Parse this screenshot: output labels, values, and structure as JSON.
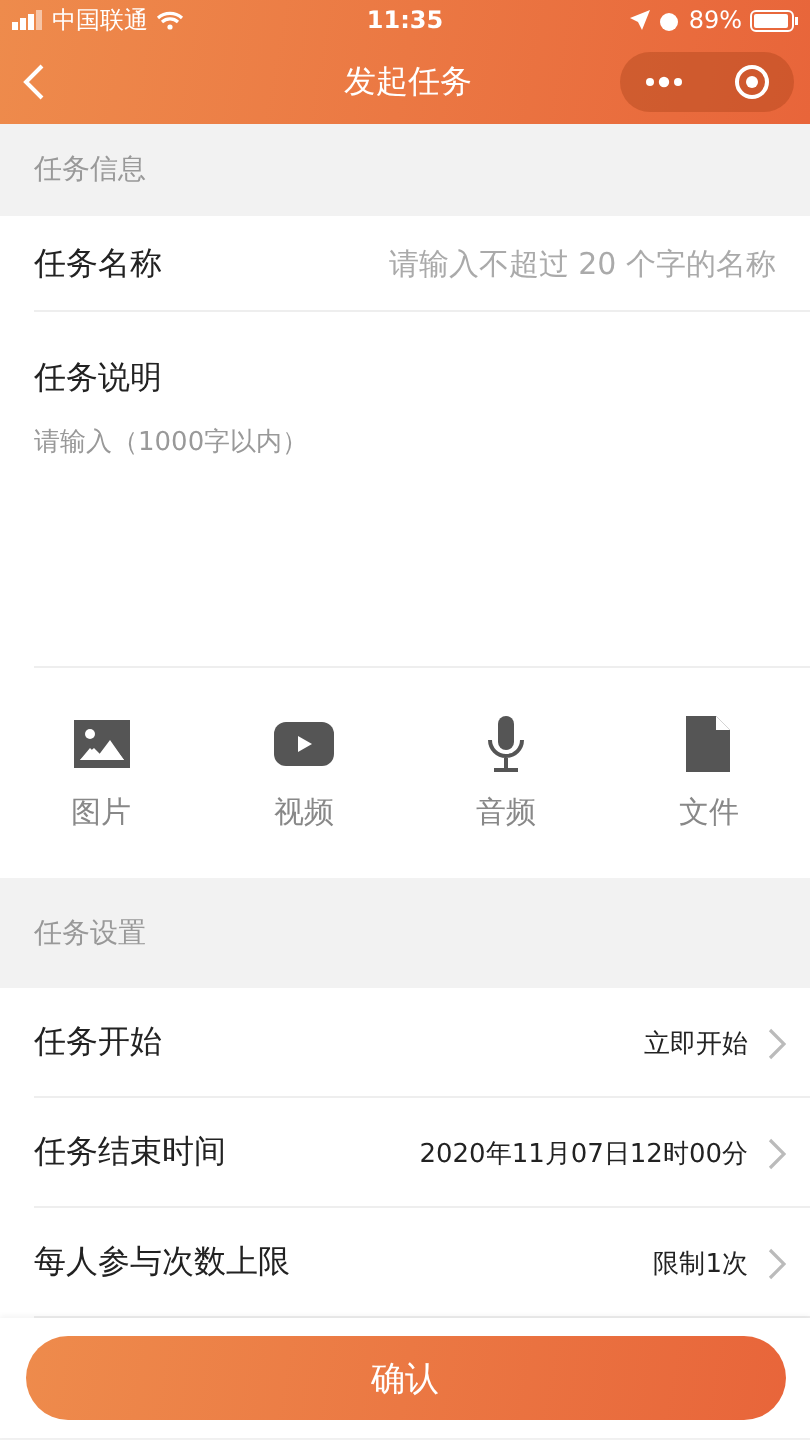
{
  "status_bar": {
    "carrier": "中国联通",
    "time": "11:35",
    "battery": "89%"
  },
  "nav": {
    "title": "发起任务"
  },
  "sections": [
    {
      "title": "任务信息"
    },
    {
      "title": "任务设置"
    }
  ],
  "task_name": {
    "label": "任务名称",
    "placeholder": "请输入不超过 20 个字的名称"
  },
  "task_description": {
    "label": "任务说明",
    "placeholder": "请输入（1000字以内）"
  },
  "attachments": [
    {
      "kind": "image",
      "label": "图片"
    },
    {
      "kind": "video",
      "label": "视频"
    },
    {
      "kind": "audio",
      "label": "音频"
    },
    {
      "kind": "file",
      "label": "文件"
    }
  ],
  "settings": [
    {
      "label": "任务开始",
      "value": "立即开始"
    },
    {
      "label": "任务结束时间",
      "value": "2020年11月07日12时00分"
    },
    {
      "label": "每人参与次数上限",
      "value": "限制1次"
    }
  ],
  "confirm_button": "确认"
}
